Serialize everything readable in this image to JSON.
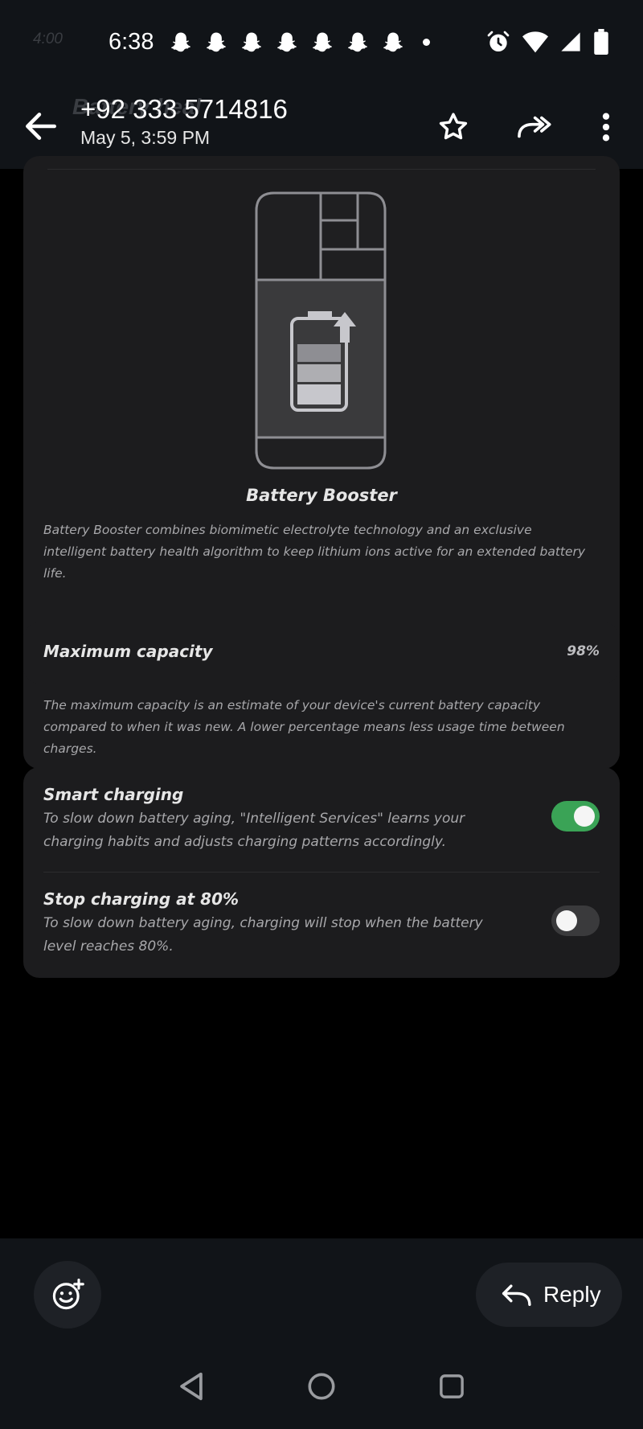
{
  "status_bar": {
    "time": "6:38",
    "ghost_time": "4:00",
    "notification_icons": [
      "snapchat-icon",
      "snapchat-icon",
      "snapchat-icon",
      "snapchat-icon",
      "snapchat-icon",
      "snapchat-icon",
      "snapchat-icon"
    ],
    "system_icons": [
      "alarm-icon",
      "wifi-icon",
      "signal-icon",
      "battery-icon"
    ]
  },
  "app_bar": {
    "sender": "+92 333 5714816",
    "date": "May 5, 3:59 PM",
    "ghost_title": "Battery heal",
    "actions": [
      "star-icon",
      "forward-icon",
      "more-vert-icon"
    ]
  },
  "battery_booster": {
    "title": "Battery Booster",
    "description": "Battery Booster combines biomimetic electrolyte technology and an exclusive intelligent battery health algorithm to keep lithium ions active for an extended battery life."
  },
  "maximum_capacity": {
    "label": "Maximum capacity",
    "value": "98%",
    "note": "The maximum capacity is an estimate of your device's current battery capacity compared to when it was new. A lower percentage means less usage time between charges."
  },
  "charging_options": [
    {
      "title": "Smart charging",
      "description": "To slow down battery aging, \"Intelligent Services\" learns your charging habits and adjusts charging patterns accordingly.",
      "enabled": true
    },
    {
      "title": "Stop charging at 80%",
      "description": "To slow down battery aging, charging will stop when the battery level reaches 80%.",
      "enabled": false
    }
  ],
  "bottom_bar": {
    "reply_label": "Reply",
    "emoji_icon": "add-reaction-icon"
  },
  "nav_bar": [
    "back-triangle-icon",
    "home-circle-icon",
    "recents-square-icon"
  ],
  "colors": {
    "toggle_on": "#3aa356",
    "bar_background": "#111418",
    "card_background": "#1c1c1e"
  }
}
